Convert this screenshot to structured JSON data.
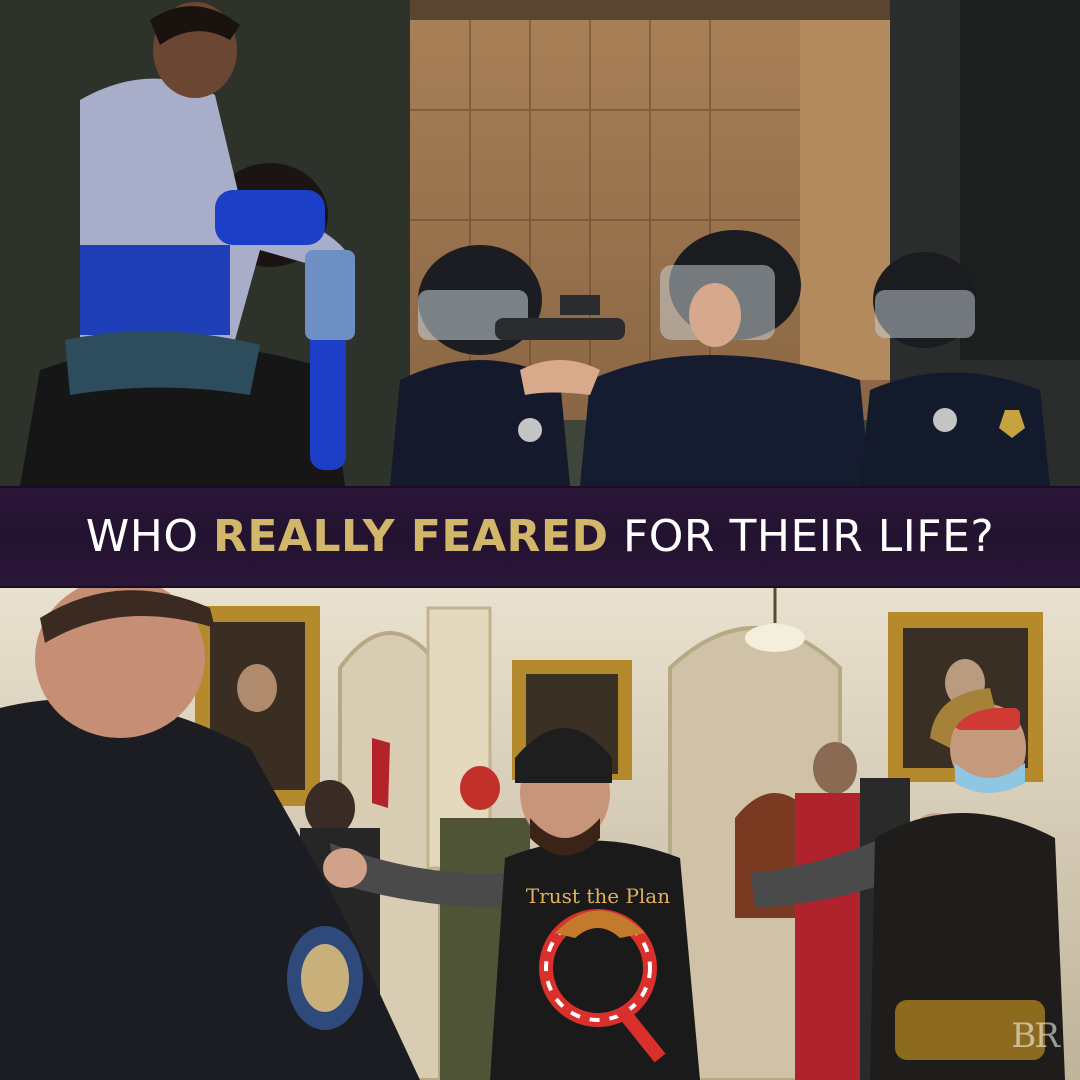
{
  "banner": {
    "prefix": "WHO ",
    "highlight": "REALLY FEARED",
    "suffix": " FOR THEIR LIFE?"
  },
  "shirt_text": "Trust the Plan",
  "watermark": "BR",
  "colors": {
    "banner_background": "#2b1638",
    "highlight_gold": "#d2b66a",
    "text_white": "#ffffff"
  }
}
